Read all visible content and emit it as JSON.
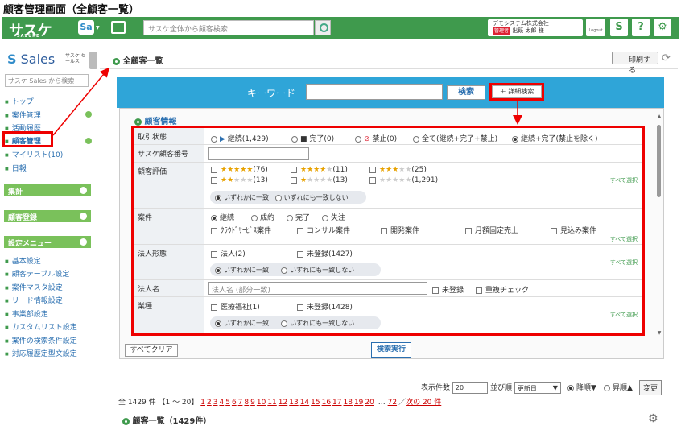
{
  "caption": "顧客管理画面（全顧客一覧）",
  "topbar": {
    "logo": "サスケ",
    "logo_sub": "SASUKE",
    "app_badge": "Sa",
    "search_placeholder": "サスケ全体から顧客検索",
    "company": "デモシステム株式会社",
    "role_badge": "管理者",
    "user": "出既 太郎 様",
    "logout": "Logout",
    "sasuke_icon": "S",
    "help": "?",
    "settings_icon": "gear-icon"
  },
  "sidebar": {
    "logo_sales": "Sales",
    "logo_sub": "サスケ セールス",
    "search_placeholder": "サスケ Sales から検索",
    "items": [
      {
        "label": "トップ"
      },
      {
        "label": "案件管理"
      },
      {
        "label": "活動履歴"
      },
      {
        "label": "顧客管理"
      },
      {
        "label": "マイリスト(10)"
      },
      {
        "label": "日報"
      }
    ],
    "sec_shukei": "集計",
    "sec_touroku": "顧客登録",
    "sec_settings": "設定メニュー",
    "settings_items": [
      {
        "label": "基本設定"
      },
      {
        "label": "顧客テーブル設定"
      },
      {
        "label": "案件マスタ設定"
      },
      {
        "label": "リード情報設定"
      },
      {
        "label": "事業部設定"
      },
      {
        "label": "カスタムリスト設定"
      },
      {
        "label": "案件の検索条件設定"
      },
      {
        "label": "対応履歴定型文設定"
      }
    ]
  },
  "header": {
    "title": "全顧客一覧",
    "print": "印刷する"
  },
  "keyword": {
    "label": "キーワード",
    "search": "検索",
    "advanced": "＋ 詳細検索"
  },
  "panel": {
    "title": "顧客情報",
    "status_label": "取引状態",
    "status": [
      "継続(1,429)",
      "完了(0)",
      "禁止(0)",
      "全て(継続+完了+禁止)",
      "継続+完了(禁止を除く)"
    ],
    "number_label": "サスケ顧客番号",
    "rating_label": "顧客評価",
    "ratings": [
      "(76)",
      "(11)",
      "(25)",
      "(13)",
      "(13)",
      "(1,291)"
    ],
    "match_any": "いずれかに一致",
    "match_none": "いずれにも一致しない",
    "all_select": "すべて選択",
    "deal_label": "案件",
    "deal_status": [
      "継続",
      "成約",
      "完了",
      "失注"
    ],
    "deal_types": [
      "ｸﾗｳﾄﾞｻｰﾋﾞｽ案件",
      "コンサル案件",
      "開発案件",
      "月額固定売上",
      "見込み案件"
    ],
    "corp_label": "法人形態",
    "corp": [
      "法人(2)",
      "未登録(1427)"
    ],
    "corpname_label": "法人名",
    "corpname_placeholder": "法人名 (部分一致)",
    "unregistered": "未登録",
    "dup_check": "重複チェック",
    "industry_label": "業種",
    "industry": [
      "医療福祉(1)",
      "未登録(1428)"
    ]
  },
  "actions": {
    "clear": "すべてクリア",
    "execute": "検索実行"
  },
  "paging": {
    "count_label": "表示件数",
    "count": "20",
    "order_label": "並び順",
    "order": "更新日",
    "desc": "降順▼",
    "asc": "昇順▲",
    "change": "変更",
    "total": "全 1429 件 【1 ～ 20】",
    "pages": [
      "1",
      "2",
      "3",
      "4",
      "5",
      "6",
      "7",
      "8",
      "9",
      "10",
      "11",
      "12",
      "13",
      "14",
      "15",
      "16",
      "17",
      "18",
      "19",
      "20"
    ],
    "ellipsis": "…",
    "last": "72",
    "next": "次の 20 件"
  },
  "list_title": "顧客一覧（1429件）"
}
